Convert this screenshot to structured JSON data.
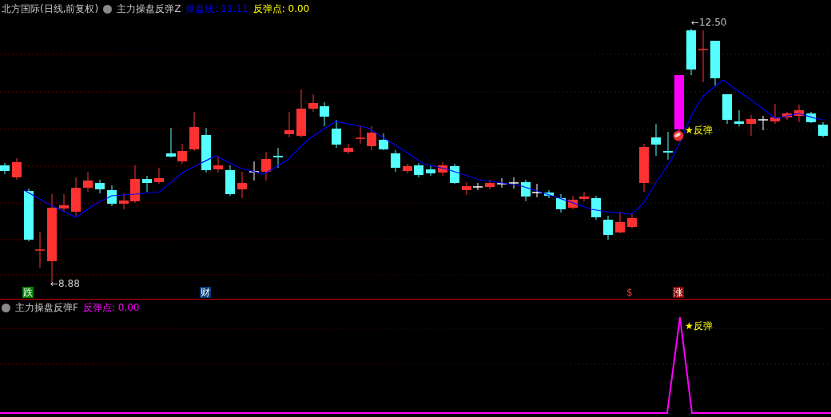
{
  "main_panel": {
    "security": "北方国际(日线,前复权)",
    "indicator": "主力操盘反弹Z",
    "legend": [
      {
        "label": "操盘线:",
        "value": "11.11",
        "color": "#0000ff"
      },
      {
        "label": "反弹点:",
        "value": "0.00",
        "color": "#ffff00"
      }
    ],
    "annotations": [
      {
        "kind": "low",
        "text": "←8.88"
      },
      {
        "kind": "high",
        "text": "←12.50"
      },
      {
        "kind": "signal",
        "text": "★反弹"
      }
    ],
    "markers": [
      {
        "text": "跌",
        "color": "#008000"
      },
      {
        "text": "财",
        "color": "#003c78"
      },
      {
        "text": "$",
        "color": "#000000"
      },
      {
        "text": "涨",
        "color": "#8b0000"
      }
    ]
  },
  "sub_panel": {
    "indicator": "主力操盘反弹F",
    "legend": [
      {
        "label": "反弹点:",
        "value": "0.00",
        "color": "#ff00ff"
      }
    ],
    "signal_label": "★反弹"
  }
}
